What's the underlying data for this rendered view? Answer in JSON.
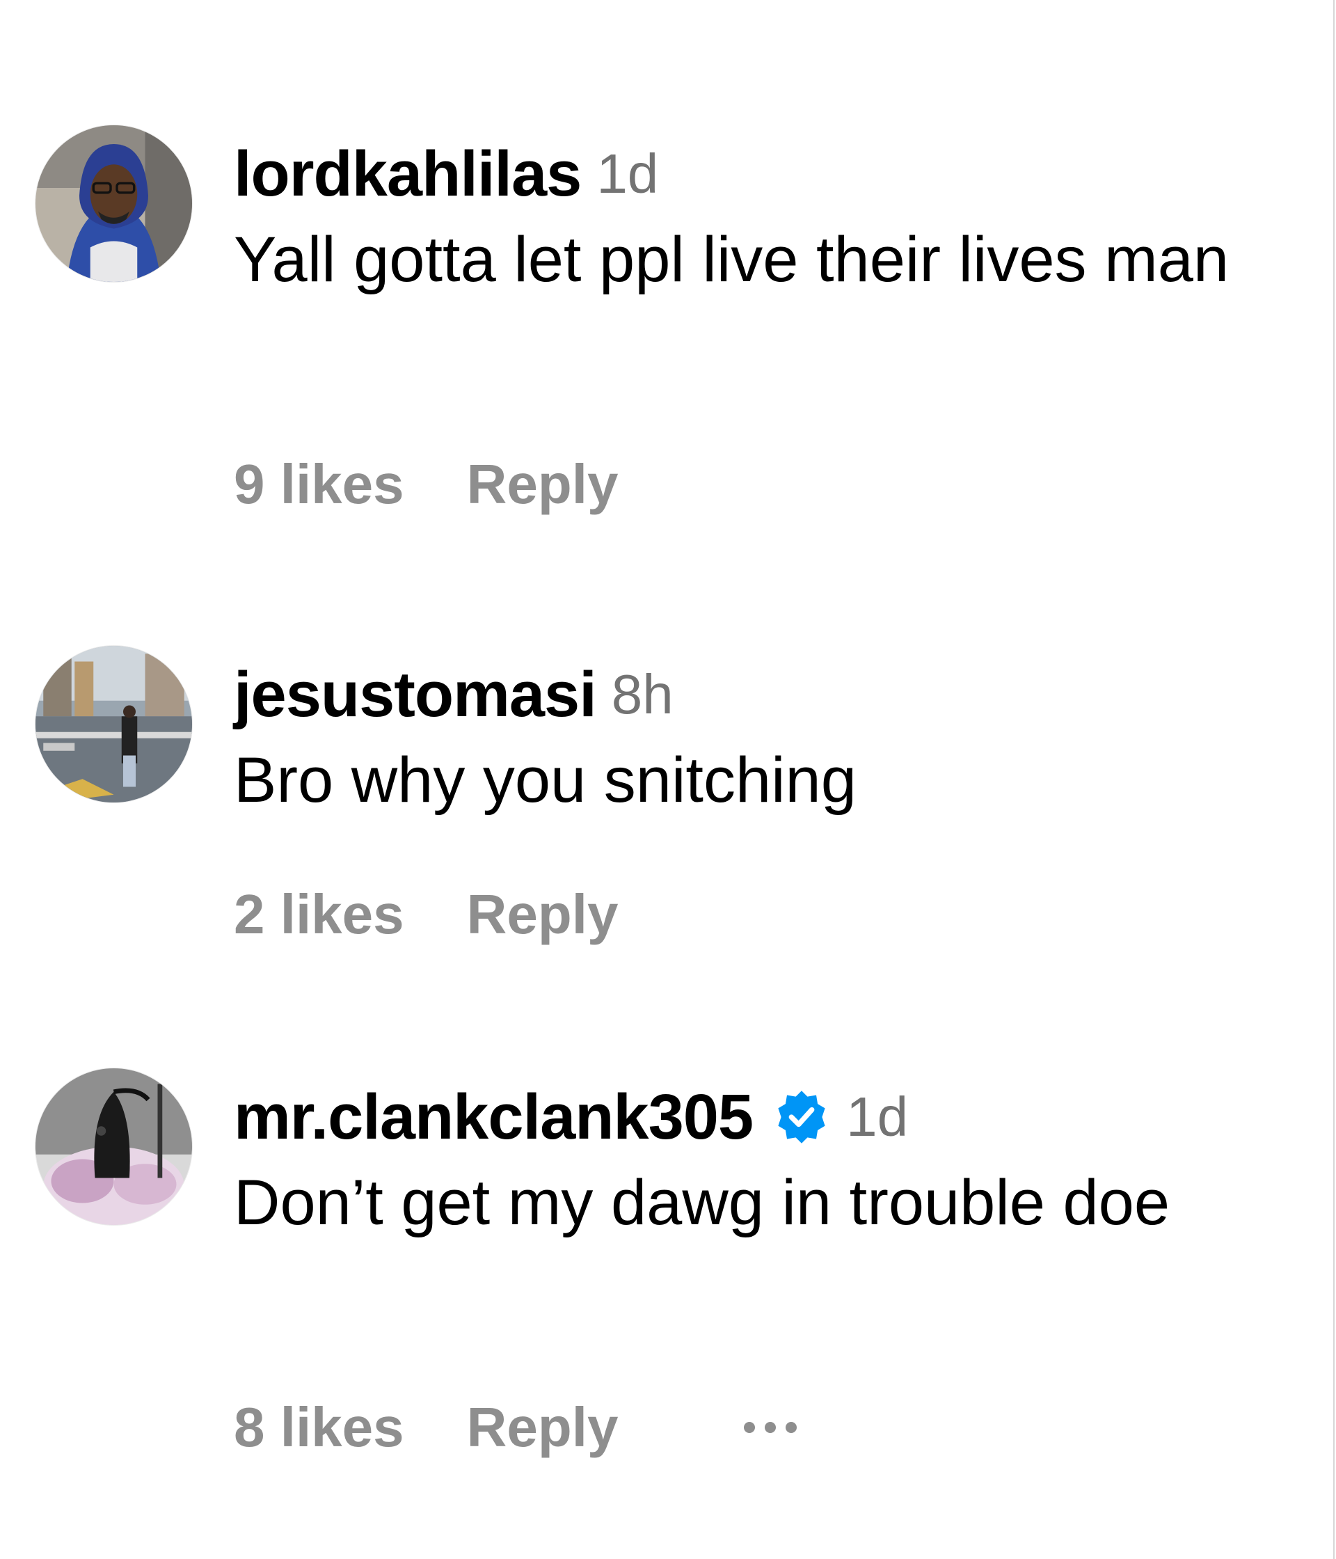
{
  "comments": [
    {
      "username": "lordkahlilas",
      "time": "1d",
      "verified": false,
      "text": "Yall gotta let ppl live their lives man",
      "likes": "9 likes",
      "reply": "Reply"
    },
    {
      "username": "jesustomasi",
      "time": "8h",
      "verified": false,
      "text": "Bro why you snitching",
      "likes": "2 likes",
      "reply": "Reply"
    },
    {
      "username": "mr.clankclank305",
      "time": "1d",
      "verified": true,
      "text": "Don’t get my dawg in trouble doe",
      "likes": "8 likes",
      "reply": "Reply",
      "more": "more-options-icon"
    }
  ],
  "colors": {
    "secondary_text": "#737373",
    "action_text": "#8e8e8e",
    "verified_badge": "#0095f6"
  }
}
